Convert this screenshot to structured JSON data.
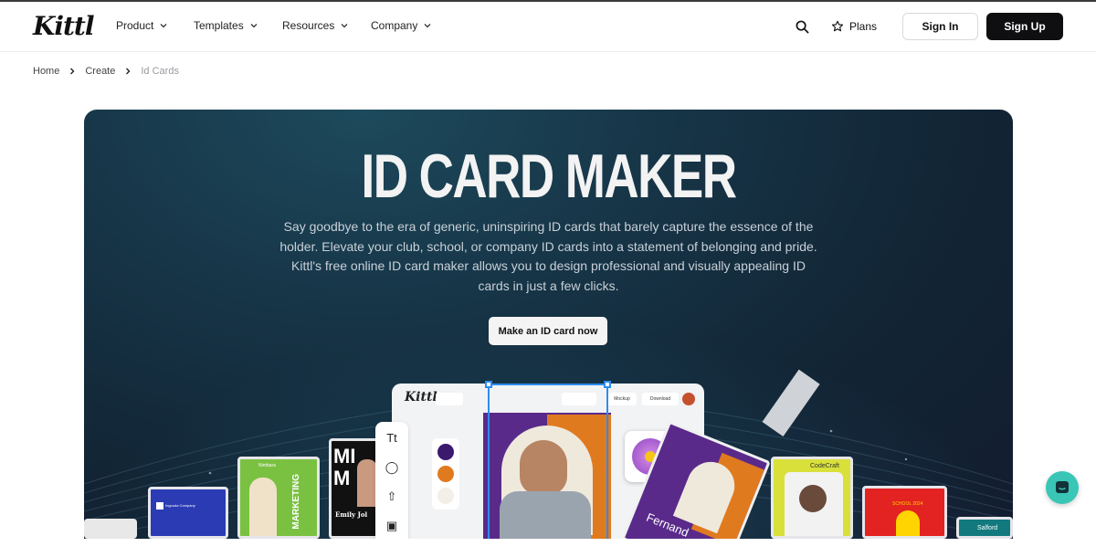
{
  "nav": {
    "logo": "Kittl",
    "menu": [
      {
        "label": "Product"
      },
      {
        "label": "Templates"
      },
      {
        "label": "Resources"
      },
      {
        "label": "Company"
      }
    ],
    "plans_label": "Plans",
    "signin_label": "Sign In",
    "signup_label": "Sign Up"
  },
  "breadcrumb": {
    "home": "Home",
    "create": "Create",
    "current": "Id Cards"
  },
  "hero": {
    "title": "ID CARD MAKER",
    "description": "Say goodbye to the era of generic, uninspiring ID cards that barely capture the essence of the holder. Elevate your club, school, or company ID cards into a statement of belonging and pride. Kittl's free online ID card maker allows you to design professional and visually appealing ID cards in just a few clicks.",
    "cta_label": "Make an ID card now"
  },
  "editor_mock": {
    "logo": "Kittl",
    "mockup_label": "Mockup",
    "download_label": "Download",
    "swatch_colors": [
      "#3b1a6e",
      "#e07a1f",
      "#f3efe6"
    ],
    "card_name": "Fernand",
    "brand_left": "Nimbara",
    "poster_text": "MARKETING",
    "card_label_codecraft": "CodeCraft",
    "card_label_school": "SCHOOL 2024",
    "card_label_salford": "Salford",
    "card_label_emily": "Emily Jol"
  },
  "colors": {
    "accent_blue": "#2d8cf0",
    "card_purple": "#5a2a8a",
    "card_orange": "#e07a1f",
    "card_green": "#7ac142",
    "chat_teal": "#39c6b6"
  }
}
